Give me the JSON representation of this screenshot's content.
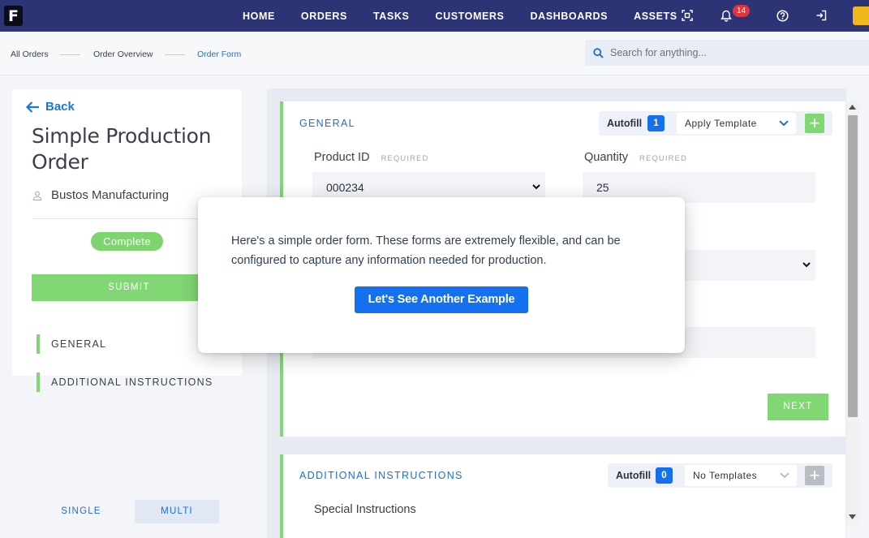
{
  "nav": {
    "logo": "F",
    "links": [
      "HOME",
      "ORDERS",
      "TASKS",
      "CUSTOMERS",
      "DASHBOARDS",
      "ASSETS"
    ],
    "notification_count": "14",
    "icons": [
      "scan-icon",
      "bell-icon",
      "help-icon",
      "logout-icon"
    ]
  },
  "breadcrumb": {
    "items": [
      "All Orders",
      "Order Overview",
      "Order Form"
    ]
  },
  "search": {
    "placeholder": "Search for anything..."
  },
  "order": {
    "back_label": "Back",
    "title": "Simple Production Order",
    "company": "Bustos Manufacturing",
    "status": "Complete",
    "submit_label": "SUBMIT",
    "sections": [
      "GENERAL",
      "ADDITIONAL INSTRUCTIONS"
    ],
    "view_toggle": [
      "SINGLE",
      "MULTI"
    ]
  },
  "general": {
    "title": "GENERAL",
    "autofill_label": "Autofill",
    "autofill_count": "1",
    "template_select": "Apply Template",
    "fields": {
      "product_id_label": "Product ID",
      "product_id_value": "000234",
      "quantity_label": "Quantity",
      "quantity_value": "25",
      "required_tag": "REQUIRED"
    },
    "next_label": "NEXT"
  },
  "additional": {
    "title": "ADDITIONAL INSTRUCTIONS",
    "autofill_label": "Autofill",
    "autofill_count": "0",
    "template_select": "No Templates",
    "special_label": "Special Instructions"
  },
  "modal": {
    "text": "Here's a simple order form. These forms are extremely flexible, and can be configured to capture any information needed for production.",
    "button_label": "Let's See Another Example"
  },
  "colors": {
    "nav_bg": "#2c3475",
    "accent_green": "#80d773",
    "accent_blue": "#1570ef",
    "badge_red": "#e0353f"
  }
}
